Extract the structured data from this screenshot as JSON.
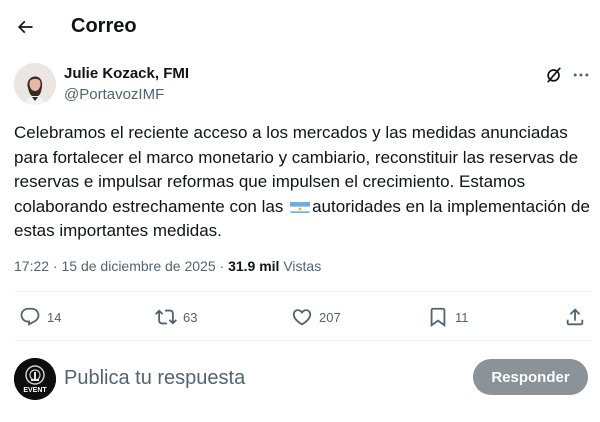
{
  "header": {
    "title": "Correo",
    "back_icon": "arrow-left-icon"
  },
  "post": {
    "author": {
      "name": "Julie Kozack, FMI",
      "handle": "@PortavozIMF"
    },
    "text_part1": "Celebramos el reciente acceso a los mercados y las medidas anunciadas para fortalecer el marco monetario y cambiario, reconstituir las reservas de reservas e impulsar reformas que impulsen el crecimiento. Estamos colaborando estrechamente con las ",
    "flag_icon": "argentina-flag-icon",
    "text_part2": "autoridades en la implementación de estas importantes medidas.",
    "time": "17:22",
    "dot1": "·",
    "date": "15 de diciembre de 2025",
    "dot2": "·",
    "views_count": "31.9 mil",
    "views_label": "Vistas"
  },
  "actions": {
    "replies": "14",
    "reposts": "63",
    "likes": "207",
    "bookmarks": "11"
  },
  "reply_box": {
    "placeholder": "Publica tu respuesta",
    "button_label": "Responder",
    "avatar_text": "EVENT"
  },
  "colors": {
    "text": "#0f1419",
    "secondary": "#536471",
    "divider": "#eff3f4",
    "button_disabled": "#8b9398"
  }
}
